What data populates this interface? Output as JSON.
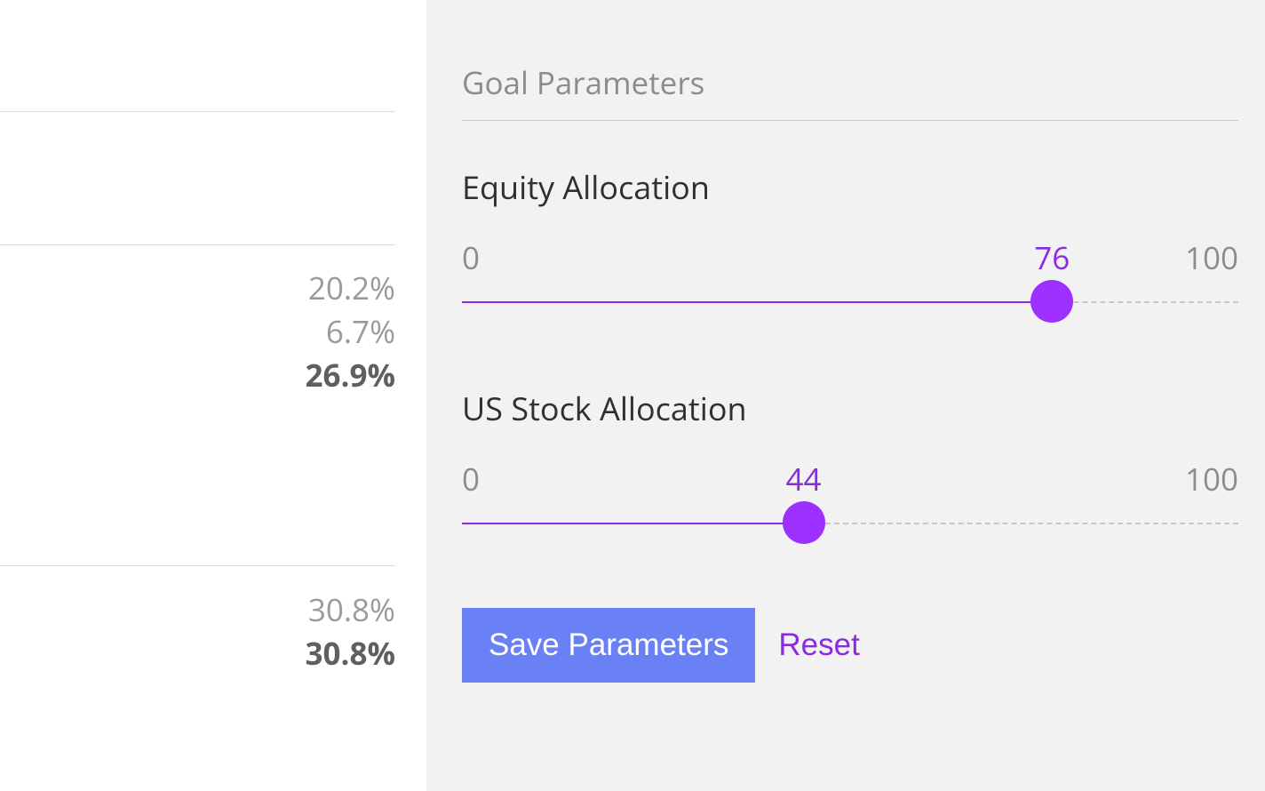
{
  "left": {
    "group1": {
      "row1": "20.2%",
      "row2": "6.7%",
      "total": "26.9%"
    },
    "group2": {
      "row1": "30.8%",
      "total": "30.8%"
    }
  },
  "right": {
    "section_title": "Goal Parameters",
    "sliders": {
      "equity": {
        "label": "Equity Allocation",
        "min": "0",
        "max": "100",
        "value": "76",
        "percent": 76
      },
      "us_stock": {
        "label": "US Stock Allocation",
        "min": "0",
        "max": "100",
        "value": "44",
        "percent": 44
      }
    },
    "buttons": {
      "save": "Save Parameters",
      "reset": "Reset"
    }
  },
  "colors": {
    "accent_purple": "#9b30ff",
    "accent_blue": "#6a80f5"
  }
}
